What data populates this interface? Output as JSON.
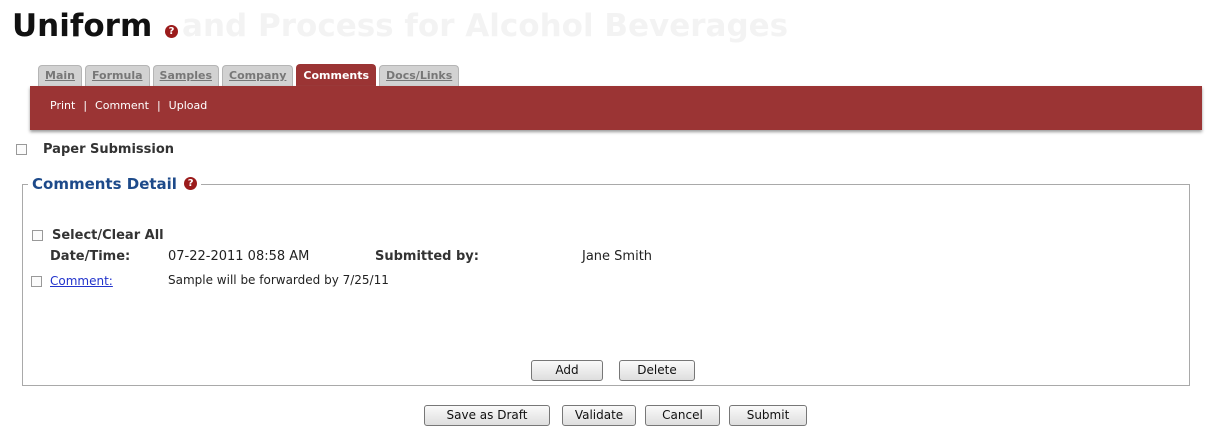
{
  "page": {
    "title": "Uniform",
    "title_faded": "and Process for Alcohol Beverages",
    "help_icon": "question-icon"
  },
  "tabs": [
    {
      "label": "Main",
      "active": false
    },
    {
      "label": "Formula",
      "active": false
    },
    {
      "label": "Samples",
      "active": false
    },
    {
      "label": "Company",
      "active": false
    },
    {
      "label": "Comments",
      "active": true
    },
    {
      "label": "Docs/Links",
      "active": false
    }
  ],
  "subnav": {
    "print": "Print",
    "comment": "Comment",
    "upload": "Upload",
    "separator": "|"
  },
  "paper_submission": {
    "label": "Paper Submission",
    "checked": false
  },
  "comments_detail": {
    "legend": "Comments Detail",
    "select_all_label": "Select/Clear All",
    "datetime_label": "Date/Time:",
    "datetime_value": "07-22-2011 08:58 AM",
    "submitted_by_label": "Submitted by:",
    "submitted_by_value": "Jane Smith",
    "comment_link": "Comment:",
    "comment_text": "Sample will be forwarded by 7/25/11",
    "add_label": "Add",
    "delete_label": "Delete"
  },
  "actions": {
    "save_draft": "Save as Draft",
    "validate": "Validate",
    "cancel": "Cancel",
    "submit": "Submit"
  },
  "colors": {
    "accent": "#9b3434",
    "legend": "#1d4a8a",
    "link": "#2233cc",
    "help": "#9b1b1b"
  }
}
